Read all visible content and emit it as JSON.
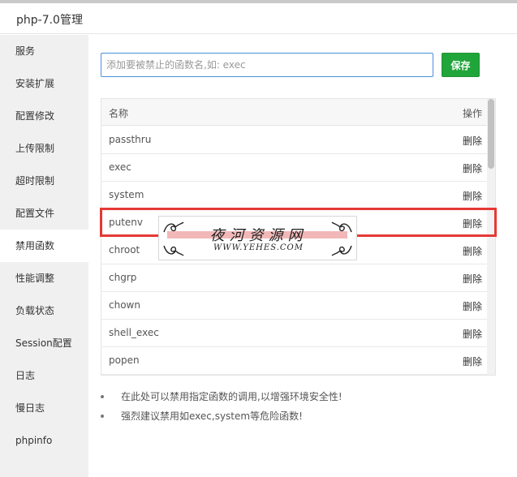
{
  "window": {
    "title": "php-7.0管理"
  },
  "sidebar": {
    "items": [
      {
        "label": "服务",
        "active": false
      },
      {
        "label": "安装扩展",
        "active": false
      },
      {
        "label": "配置修改",
        "active": false
      },
      {
        "label": "上传限制",
        "active": false
      },
      {
        "label": "超时限制",
        "active": false
      },
      {
        "label": "配置文件",
        "active": false
      },
      {
        "label": "禁用函数",
        "active": true
      },
      {
        "label": "性能调整",
        "active": false
      },
      {
        "label": "负载状态",
        "active": false
      },
      {
        "label": "Session配置",
        "active": false
      },
      {
        "label": "日志",
        "active": false
      },
      {
        "label": "慢日志",
        "active": false
      },
      {
        "label": "phpinfo",
        "active": false
      }
    ]
  },
  "form": {
    "input_value": "",
    "input_placeholder": "添加要被禁止的函数名,如: exec",
    "save_label": "保存"
  },
  "table": {
    "headers": {
      "name": "名称",
      "operation": "操作"
    },
    "rows": [
      {
        "name": "passthru",
        "action": "删除"
      },
      {
        "name": "exec",
        "action": "删除"
      },
      {
        "name": "system",
        "action": "删除"
      },
      {
        "name": "putenv",
        "action": "删除"
      },
      {
        "name": "chroot",
        "action": "删除"
      },
      {
        "name": "chgrp",
        "action": "删除"
      },
      {
        "name": "chown",
        "action": "删除"
      },
      {
        "name": "shell_exec",
        "action": "删除"
      },
      {
        "name": "popen",
        "action": "删除"
      }
    ]
  },
  "tips": [
    "在此处可以禁用指定函数的调用,以增强环境安全性!",
    "强烈建议禁用如exec,system等危险函数!"
  ],
  "watermark": {
    "title": "夜河资源网",
    "url": "WWW.YEHES.COM"
  },
  "colors": {
    "accent": "#20a53a",
    "input_border": "#4a90d9",
    "highlight": "#e53935"
  }
}
